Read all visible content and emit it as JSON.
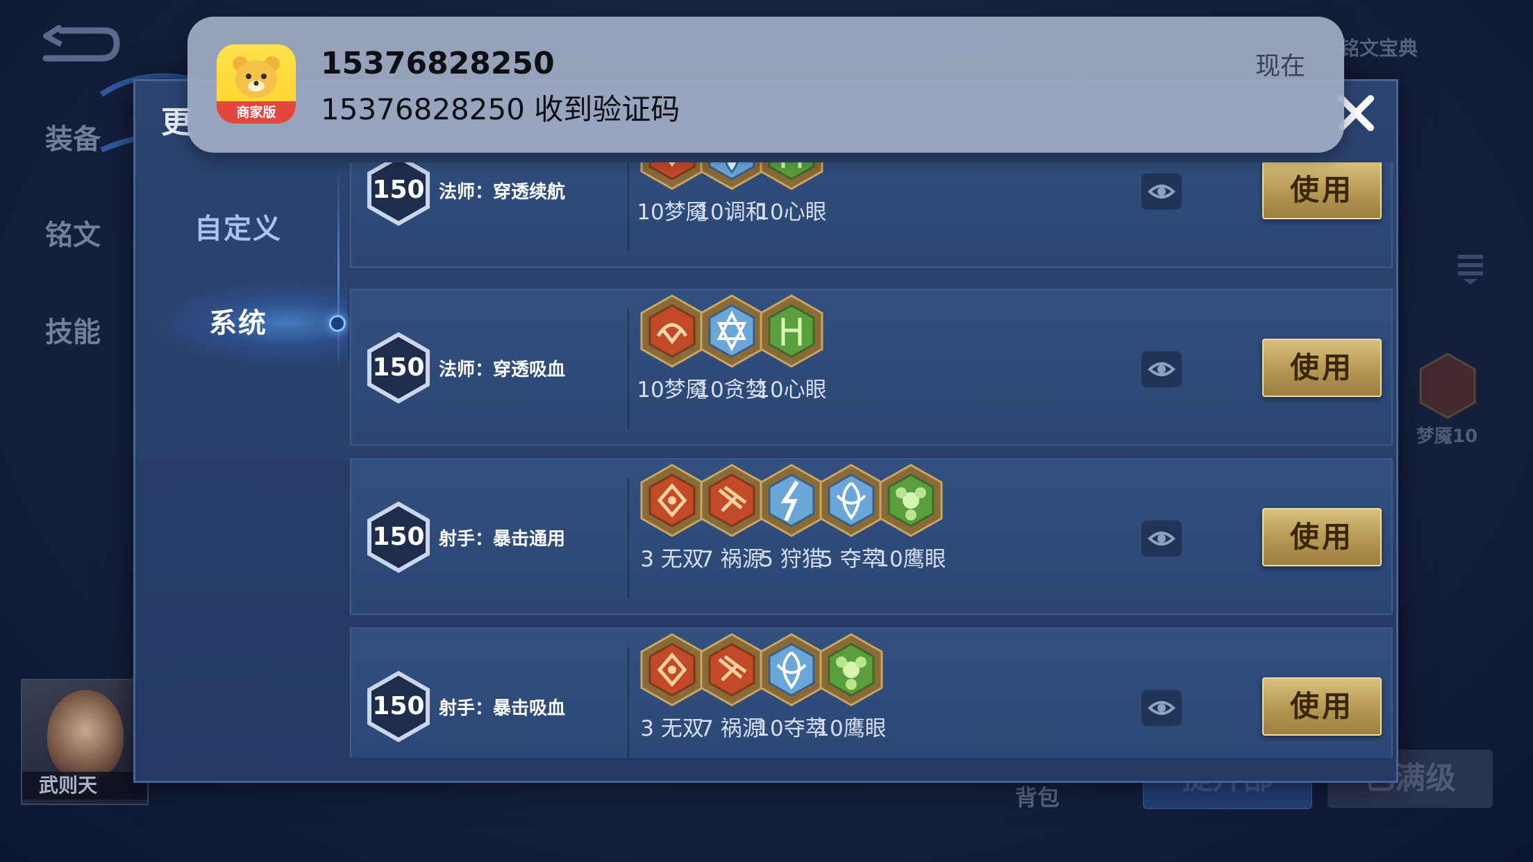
{
  "background": {
    "left_tabs": [
      "装备",
      "铭文",
      "技能"
    ],
    "hero_name": "武则天",
    "ghost_top_right": "铭文宝典",
    "ghost_right_rune": "梦魇10",
    "ghost_bag": "背包",
    "ghost_btn_left": "提升部",
    "ghost_btn_right": "已满级"
  },
  "panel": {
    "title": "更",
    "nav": {
      "custom": "自定义",
      "system": "系统"
    }
  },
  "presets": [
    {
      "level": "150",
      "name": "法师：穿透续航",
      "use_label": "使用",
      "runes": [
        {
          "label": "10梦魇",
          "kind": "red-a"
        },
        {
          "label": "10调和",
          "kind": "blue-drop"
        },
        {
          "label": "10心眼",
          "kind": "green-a"
        }
      ]
    },
    {
      "level": "150",
      "name": "法师：穿透吸血",
      "use_label": "使用",
      "runes": [
        {
          "label": "10梦魇",
          "kind": "red-a"
        },
        {
          "label": "10贪婪",
          "kind": "blue-star"
        },
        {
          "label": "10心眼",
          "kind": "green-a"
        }
      ]
    },
    {
      "level": "150",
      "name": "射手：暴击通用",
      "use_label": "使用",
      "runes": [
        {
          "label": "3 无双",
          "kind": "red-b"
        },
        {
          "label": "7 祸源",
          "kind": "red-c"
        },
        {
          "label": "5 狩猎",
          "kind": "blue-bolt"
        },
        {
          "label": "5 夺萃",
          "kind": "blue-knot"
        },
        {
          "label": "10鹰眼",
          "kind": "green-b"
        }
      ]
    },
    {
      "level": "150",
      "name": "射手：暴击吸血",
      "use_label": "使用",
      "runes": [
        {
          "label": "3 无双",
          "kind": "red-b"
        },
        {
          "label": "7 祸源",
          "kind": "red-c"
        },
        {
          "label": "10夺萃",
          "kind": "blue-knot"
        },
        {
          "label": "10鹰眼",
          "kind": "green-b"
        }
      ]
    }
  ],
  "notification": {
    "app_badge": "商家版",
    "title": "15376828250",
    "body": "15376828250 收到验证码",
    "time": "现在"
  },
  "colors": {
    "gold_button": "#c7ad67",
    "panel": "#2a4270",
    "red_rune": "#c4482a",
    "blue_rune": "#6fb0e0",
    "green_rune": "#5aa040"
  }
}
